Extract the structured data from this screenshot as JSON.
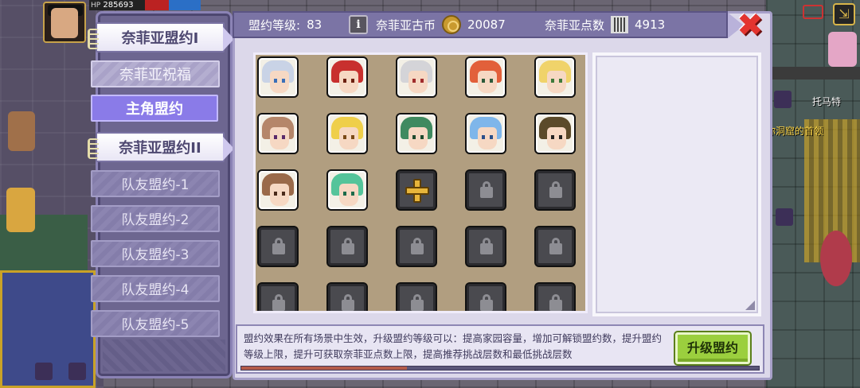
{
  "hud": {
    "hp_label": "HP",
    "hp_value": "285693"
  },
  "world": {
    "npc_name": "托马特",
    "npc_quest": "你洞窟的首领"
  },
  "menu": {
    "tabs": [
      {
        "label": "奈菲亚盟约I",
        "state": "active"
      },
      {
        "label": "奈菲亚祝福",
        "state": "normal"
      },
      {
        "label": "主角盟约",
        "state": "highlight"
      },
      {
        "label": "奈菲亚盟约II",
        "state": "active"
      },
      {
        "label": "队友盟约-1",
        "state": "sub"
      },
      {
        "label": "队友盟约-2",
        "state": "sub"
      },
      {
        "label": "队友盟约-3",
        "state": "sub"
      },
      {
        "label": "队友盟约-4",
        "state": "sub"
      },
      {
        "label": "队友盟约-5",
        "state": "sub"
      }
    ]
  },
  "header": {
    "level_label": "盟约等级:",
    "level_value": "83",
    "coin_label": "奈菲亚古币",
    "coin_value": "20087",
    "points_label": "奈菲亚点数",
    "points_value": "4913"
  },
  "grid": {
    "heroes": [
      {
        "hair": "#c9d3e6",
        "eye": "#3b6fb8"
      },
      {
        "hair": "#c8302e",
        "eye": "#6d2010"
      },
      {
        "hair": "#d4d4d8",
        "eye": "#a02c2c"
      },
      {
        "hair": "#e2603a",
        "eye": "#2d5a3a"
      },
      {
        "hair": "#f0d36a",
        "eye": "#3f7a3b"
      },
      {
        "hair": "#b5866a",
        "eye": "#5a2a6a"
      },
      {
        "hair": "#efcf4a",
        "eye": "#7a4a18"
      },
      {
        "hair": "#3f8a60",
        "eye": "#1f4a2f"
      },
      {
        "hair": "#7fb6ea",
        "eye": "#2a4f8a"
      },
      {
        "hair": "#5b4a2a",
        "eye": "#222222"
      },
      {
        "hair": "#9a6a4a",
        "eye": "#4a2a1a"
      },
      {
        "hair": "#54c49a",
        "eye": "#1d6b4a"
      }
    ],
    "add_slot_icon": "plus-icon",
    "locked_slot_icon": "padlock-icon"
  },
  "footer": {
    "description": "盟约效果在所有场景中生效，升级盟约等级可以：提高家园容量，增加可解锁盟约数，提升盟约等级上限，提升可获取奈菲亚点数上限，提高推荐挑战层数和最低挑战层数",
    "upgrade_label": "升级盟约",
    "progress": 0.32
  },
  "colors": {
    "panel": "#6d6690",
    "accent_green": "#9bcf3e",
    "close_red": "#e3342f"
  }
}
